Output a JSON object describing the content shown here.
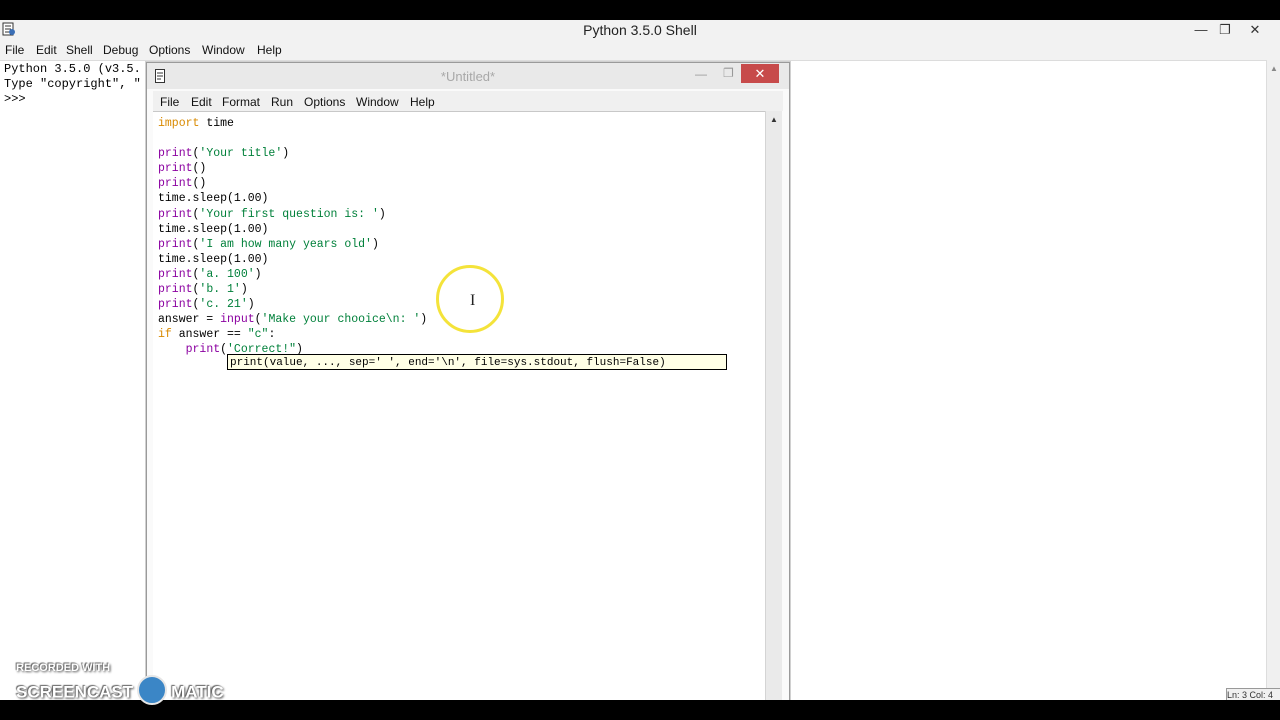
{
  "shell": {
    "title": "Python 3.5.0 Shell",
    "menu": [
      "File",
      "Edit",
      "Shell",
      "Debug",
      "Options",
      "Window",
      "Help"
    ],
    "lines": [
      "Python 3.5.0 (v3.5.",
      "Type \"copyright\", \"",
      ">>>"
    ],
    "status": "Ln: 3  Col: 4"
  },
  "editor": {
    "title": "*Untitled*",
    "menu": [
      "File",
      "Edit",
      "Format",
      "Run",
      "Options",
      "Window",
      "Help"
    ],
    "code": [
      "import time",
      "",
      "print('Your title')",
      "print()",
      "print()",
      "time.sleep(1.00)",
      "print('Your first question is: ')",
      "time.sleep(1.00)",
      "print('I am how many years old')",
      "time.sleep(1.00)",
      "print('a. 100')",
      "print('b. 1')",
      "print('c. 21')",
      "answer = input('Make your chooice\\n: ')",
      "if answer == \"c\":",
      "    print('Correct!\")"
    ],
    "calltip": "print(value, ..., sep=' ', end='\\n', file=sys.stdout, flush=False)"
  },
  "window_buttons": {
    "minimize": "—",
    "restore": "❐",
    "close": "✕"
  },
  "watermark": {
    "line1": "RECORDED WITH",
    "line2a": "SCREENCAST",
    "line2b": "MATIC"
  }
}
